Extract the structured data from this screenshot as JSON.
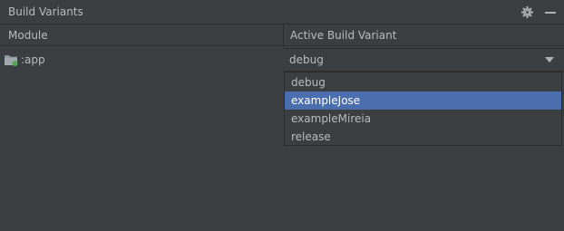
{
  "panel": {
    "title": "Build Variants",
    "actions": {
      "settings_icon": "gear-icon",
      "minimize_icon": "minimize-icon"
    }
  },
  "table": {
    "columns": [
      "Module",
      "Active Build Variant"
    ],
    "rows": [
      {
        "module": ":app",
        "module_icon": "module-folder-icon",
        "active_variant": "debug"
      }
    ]
  },
  "dropdown": {
    "open": true,
    "options": [
      "debug",
      "exampleJose",
      "exampleMireia",
      "release"
    ],
    "highlighted": "exampleJose"
  },
  "colors": {
    "background": "#3c3f41",
    "text": "#bbbbbb",
    "selection": "#4b6eaf",
    "module_badge": "#5aa55a"
  }
}
